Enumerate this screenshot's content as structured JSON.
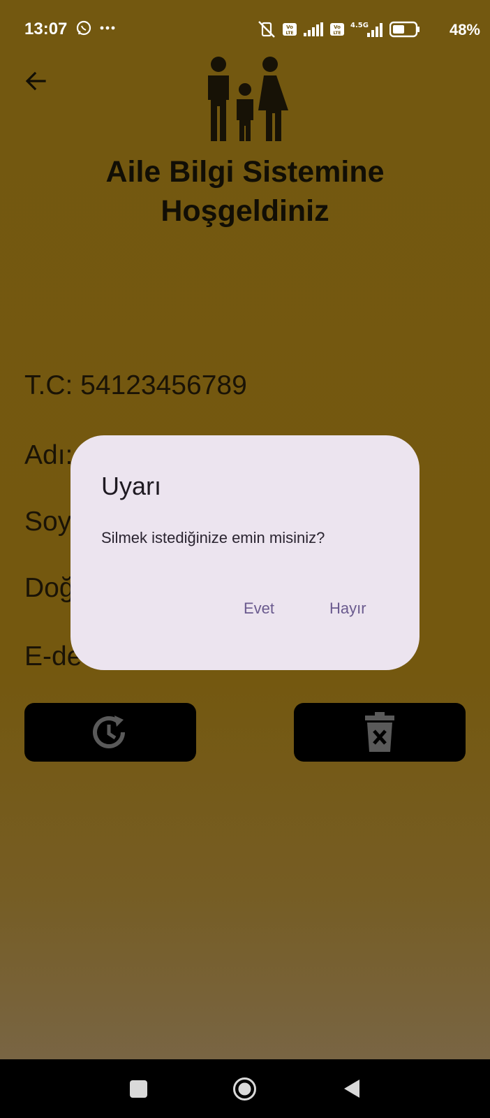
{
  "status_bar": {
    "time": "13:07",
    "battery_percent": "48%",
    "icons": [
      "whatsapp-icon",
      "more-dots-icon",
      "mute-vibrate-icon",
      "volte-icon",
      "signal-icon",
      "volte-icon",
      "network-4_5g-icon",
      "signal-icon",
      "battery-icon"
    ]
  },
  "header": {
    "title": "Aile Bilgi Sistemine Hoşgeldiniz"
  },
  "fields": {
    "tc": "T.C: 54123456789",
    "name": "Adı:",
    "surname": "Soy",
    "birth": "Doğ",
    "email": "E-de"
  },
  "dialog": {
    "title": "Uyarı",
    "message": "Silmek istediğinize emin misiniz?",
    "confirm_label": "Evet",
    "cancel_label": "Hayır"
  },
  "colors": {
    "background": "#735810",
    "dialog_bg": "#ece4ef",
    "accent": "#6a5a8e",
    "button_bg": "#000000"
  }
}
